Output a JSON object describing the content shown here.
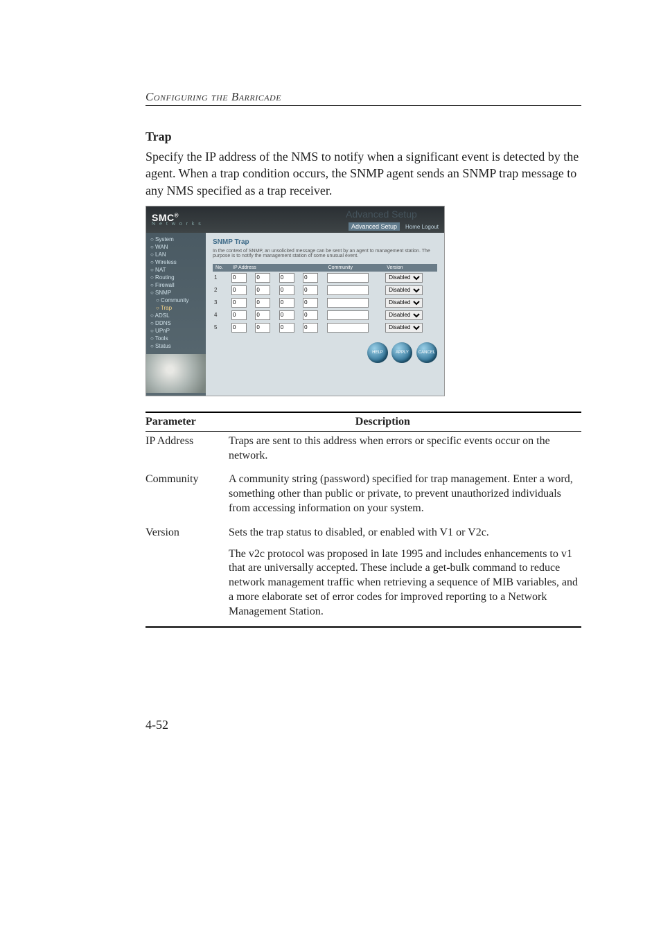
{
  "running_head": "Configuring the Barricade",
  "section": {
    "title": "Trap",
    "para": "Specify the IP address of the NMS to notify when a significant event is detected by the agent. When a trap condition occurs, the SNMP agent sends an SNMP trap message to any NMS specified as a trap receiver."
  },
  "screenshot": {
    "logo": "SMC",
    "logo_sub": "N e t w o r k s",
    "title_main": "Advanced Setup",
    "title_sub": "Advanced Setup",
    "title_links": "Home  Logout",
    "nav": [
      {
        "label": "System"
      },
      {
        "label": "WAN"
      },
      {
        "label": "LAN"
      },
      {
        "label": "Wireless"
      },
      {
        "label": "NAT"
      },
      {
        "label": "Routing"
      },
      {
        "label": "Firewall"
      },
      {
        "label": "SNMP"
      },
      {
        "label": "Community",
        "cls": "sub1"
      },
      {
        "label": "Trap",
        "cls": "sub1 sel"
      },
      {
        "label": "ADSL"
      },
      {
        "label": "DDNS"
      },
      {
        "label": "UPnP"
      },
      {
        "label": "Tools"
      },
      {
        "label": "Status"
      }
    ],
    "panel_title": "SNMP Trap",
    "panel_desc": "In the context of SNMP, an unsolicited message can be sent by an agent to management station. The purpose is to notify the management station of some unusual event.",
    "cols": {
      "no": "No.",
      "ip": "IP Address",
      "comm": "Community",
      "ver": "Version"
    },
    "rows": [
      {
        "no": "1",
        "ip": [
          "0",
          "0",
          "0",
          "0"
        ],
        "comm": "",
        "ver": "Disabled"
      },
      {
        "no": "2",
        "ip": [
          "0",
          "0",
          "0",
          "0"
        ],
        "comm": "",
        "ver": "Disabled"
      },
      {
        "no": "3",
        "ip": [
          "0",
          "0",
          "0",
          "0"
        ],
        "comm": "",
        "ver": "Disabled"
      },
      {
        "no": "4",
        "ip": [
          "0",
          "0",
          "0",
          "0"
        ],
        "comm": "",
        "ver": "Disabled"
      },
      {
        "no": "5",
        "ip": [
          "0",
          "0",
          "0",
          "0"
        ],
        "comm": "",
        "ver": "Disabled"
      }
    ],
    "buttons": {
      "help": "HELP",
      "apply": "APPLY",
      "cancel": "CANCEL"
    }
  },
  "param_table": {
    "head_param": "Parameter",
    "head_desc": "Description",
    "rows": [
      {
        "param": "IP Address",
        "desc": "Traps are sent to this address when errors or specific events occur on the network."
      },
      {
        "param": "Community",
        "desc": "A community string (password) specified for trap management. Enter a word, something other than public or private, to prevent unauthorized individuals from accessing information on your system."
      },
      {
        "param": "Version",
        "desc": "Sets the trap status to disabled, or enabled with V1 or V2c.",
        "desc2": "The v2c protocol was proposed in late 1995 and includes enhancements to v1 that are universally accepted. These include a get-bulk command to reduce network management traffic when retrieving a sequence of MIB variables, and a more elaborate set of error codes for improved reporting to a Network Management Station."
      }
    ]
  },
  "page_number": "4-52"
}
